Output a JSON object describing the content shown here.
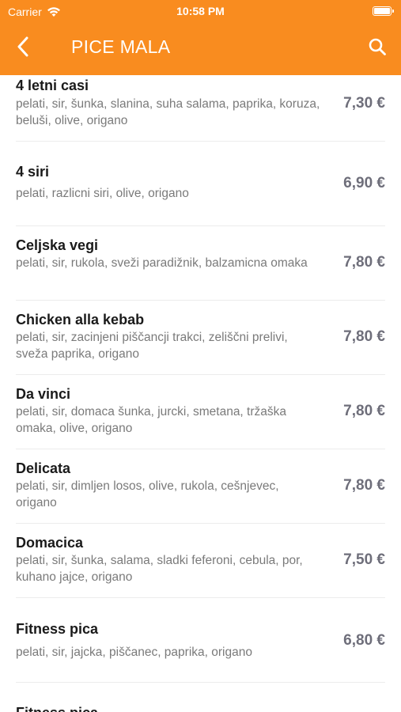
{
  "status_bar": {
    "carrier": "Carrier",
    "time": "10:58 PM"
  },
  "nav": {
    "title": "PICE MALA"
  },
  "colors": {
    "header_bg": "#f98c1f",
    "price": "#6e6e7a",
    "description": "#7a7a7a"
  },
  "icons": {
    "back": "chevron-left-icon",
    "search": "search-icon",
    "wifi": "wifi-icon",
    "battery": "battery-icon"
  },
  "items": [
    {
      "name": "4 letni casi",
      "description": "pelati, sir, šunka, slanina, suha salama, paprika, koruza, beluši, olive, origano",
      "price": "7,30 €"
    },
    {
      "name": "4 siri",
      "description": "pelati, razlicni siri, olive, origano",
      "price": "6,90 €"
    },
    {
      "name": "Celjska vegi",
      "description": "pelati, sir, rukola, sveži paradižnik, balzamicna omaka",
      "price": "7,80 €"
    },
    {
      "name": "Chicken alla kebab",
      "description": "pelati, sir, zacinjeni piščancji trakci, zeliščni prelivi, sveža paprika, origano",
      "price": "7,80 €"
    },
    {
      "name": "Da vinci",
      "description": "pelati, sir, domaca šunka, jurcki, smetana, tržaška omaka, olive, origano",
      "price": "7,80 €"
    },
    {
      "name": "Delicata",
      "description": "pelati, sir, dimljen losos, olive, rukola, cešnjevec, origano",
      "price": "7,80 €"
    },
    {
      "name": "Domacica",
      "description": "pelati, sir, šunka, salama, sladki feferoni, cebula, por, kuhano jajce, origano",
      "price": "7,50 €"
    },
    {
      "name": "Fitness pica",
      "description": "pelati, sir, jajcka, piščanec, paprika, origano",
      "price": "6,80 €"
    },
    {
      "name": "Fitness pica",
      "description": "",
      "price": ""
    }
  ]
}
